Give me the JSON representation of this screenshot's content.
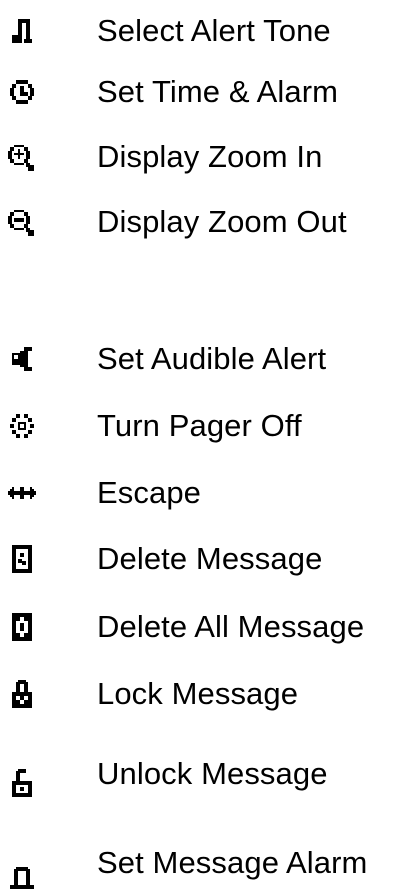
{
  "items": [
    {
      "label": "Select Alert Tone",
      "icon": "music-note-icon"
    },
    {
      "label": "Set Time & Alarm",
      "icon": "clock-icon"
    },
    {
      "label": "Display Zoom In",
      "icon": "zoom-in-icon"
    },
    {
      "label": "Display Zoom Out",
      "icon": "zoom-out-icon"
    },
    {
      "label": "Set Audible Alert",
      "icon": "speaker-icon"
    },
    {
      "label": "Turn Pager Off",
      "icon": "power-off-icon"
    },
    {
      "label": "Escape",
      "icon": "escape-icon"
    },
    {
      "label": "Delete Message",
      "icon": "delete-message-icon"
    },
    {
      "label": "Delete All Message",
      "icon": "delete-all-icon"
    },
    {
      "label": "Lock Message",
      "icon": "lock-icon"
    },
    {
      "label": "Unlock Message",
      "icon": "unlock-icon"
    },
    {
      "label": "Set Message Alarm",
      "icon": "bell-icon"
    }
  ]
}
